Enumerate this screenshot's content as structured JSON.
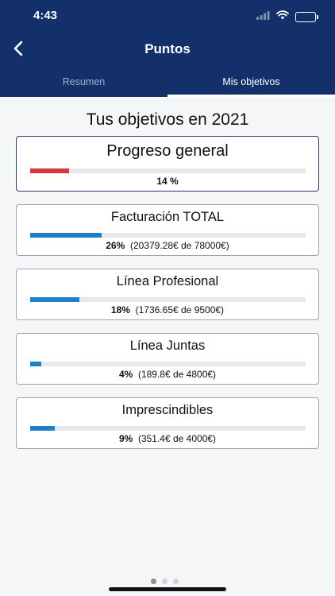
{
  "status_bar": {
    "time": "4:43"
  },
  "header": {
    "title": "Puntos"
  },
  "tabs": [
    {
      "label": "Resumen",
      "active": false
    },
    {
      "label": "Mis objetivos",
      "active": true
    }
  ],
  "page_heading": "Tus objetivos en 2021",
  "overall": {
    "title": "Progreso general",
    "percent_text": "14 %",
    "progress": 0.14,
    "color": "#d9383a"
  },
  "objectives": [
    {
      "title": "Facturación TOTAL",
      "percent_text": "26%",
      "detail": "(20379.28€ de 78000€)",
      "progress": 0.26,
      "color": "#1d82c4"
    },
    {
      "title": "Línea Profesional",
      "percent_text": "18%",
      "detail": "(1736.65€ de 9500€)",
      "progress": 0.18,
      "color": "#1d82c4"
    },
    {
      "title": "Línea Juntas",
      "percent_text": "4%",
      "detail": "(189.8€ de 4800€)",
      "progress": 0.04,
      "color": "#1d82c4"
    },
    {
      "title": "Imprescindibles",
      "percent_text": "9%",
      "detail": "(351.4€ de 4000€)",
      "progress": 0.09,
      "color": "#1d82c4"
    }
  ],
  "colors": {
    "header_bg": "#13306b",
    "page_bg": "#f5f6f8"
  }
}
